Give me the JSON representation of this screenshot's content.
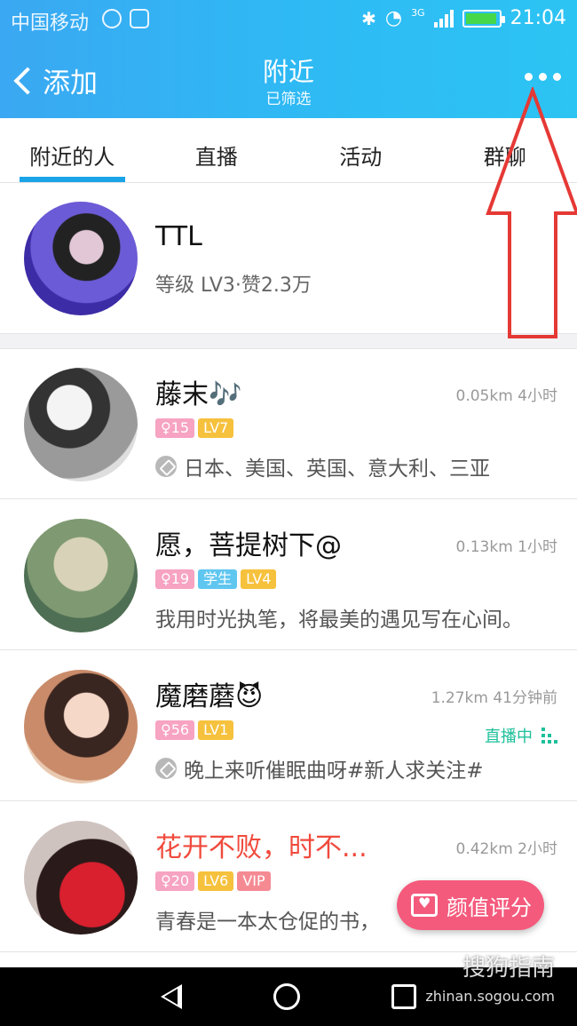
{
  "status_bar": {
    "carrier": "中国移动",
    "network": "3G",
    "time": "21:04",
    "battery_level": 0.85
  },
  "header": {
    "back_label": "添加",
    "title": "附近",
    "subtitle": "已筛选"
  },
  "tabs": [
    "附近的人",
    "直播",
    "活动",
    "群聊"
  ],
  "self_card": {
    "name": "TTL",
    "info": "等级 LV3·赞2.3万"
  },
  "people": [
    {
      "name": "藤末🎶",
      "meta": "0.05km 4小时",
      "badges": [
        "♀15",
        "LV7"
      ],
      "desc": "日本、美国、英国、意大利、三亚",
      "has_tag_icon": true
    },
    {
      "name": "愿，菩提树下@",
      "meta": "0.13km 1小时",
      "badges": [
        "♀19",
        "学生",
        "LV4"
      ],
      "desc": "我用时光执笔，将最美的遇见写在心间。",
      "has_tag_icon": false
    },
    {
      "name": "魔磨蘑😈",
      "meta": "1.27km 41分钟前",
      "badges": [
        "♀56",
        "LV1"
      ],
      "desc": "晚上来听催眠曲呀#新人求关注#",
      "has_tag_icon": true,
      "live": "直播中"
    },
    {
      "name": "花开不败，时不...",
      "meta": "0.42km 2小时",
      "badges": [
        "♀20",
        "LV6",
        "VIP"
      ],
      "desc": "青春是一本太仓促的书，",
      "has_tag_icon": false
    }
  ],
  "rate_button": "颜值评分",
  "watermark": {
    "brand": "搜狗指南",
    "url": "zhinan.sogou.com"
  },
  "colors": {
    "header_blue": "#2fb9f4",
    "tab_underline": "#1aa4e8",
    "annotation_red": "#e53935",
    "rate_pink": "#f45a7c"
  }
}
